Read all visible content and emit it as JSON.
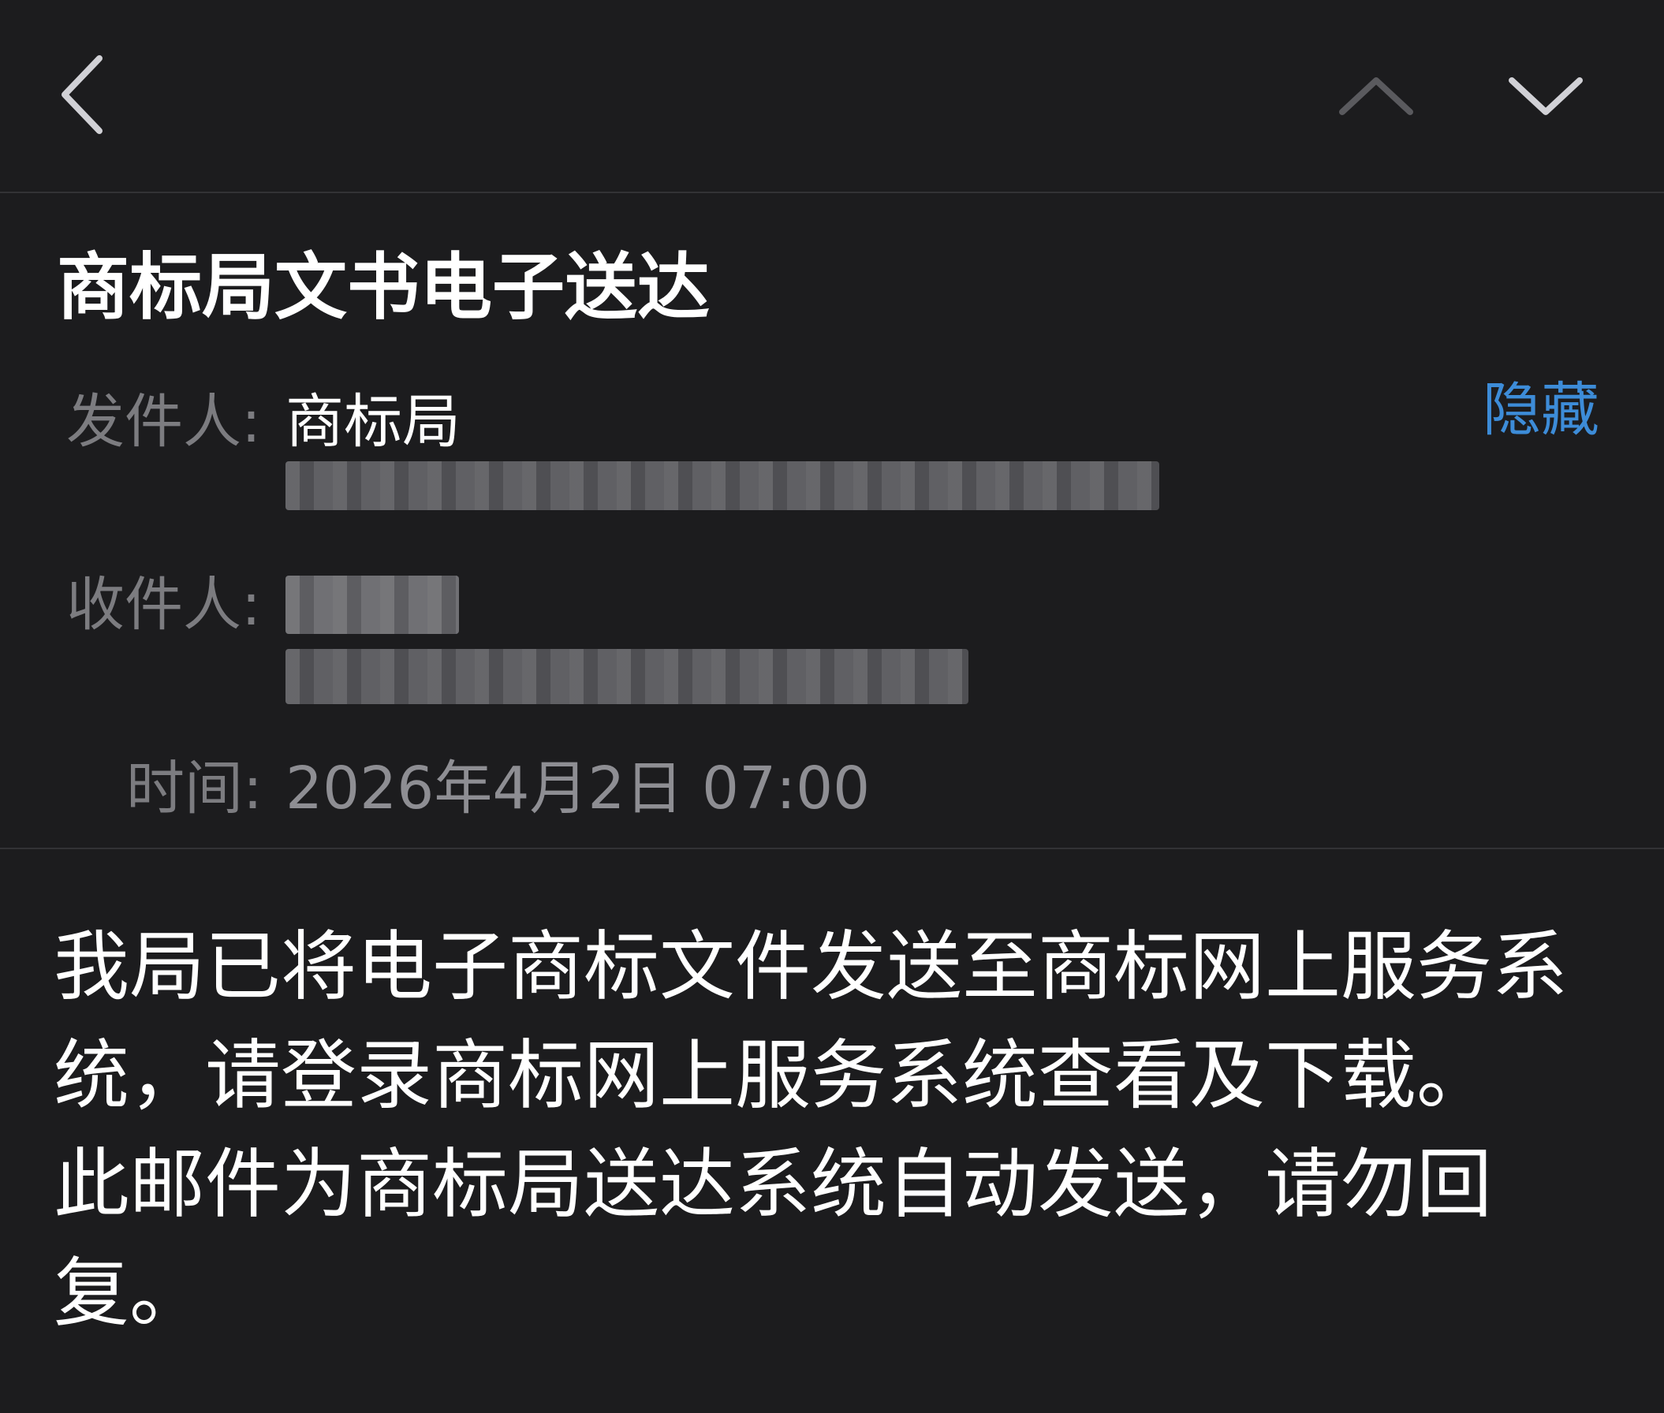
{
  "nav": {
    "back_icon": "chevron-left-icon",
    "prev_icon": "chevron-up-icon",
    "next_icon": "chevron-down-icon"
  },
  "email": {
    "subject": "商标局文书电子送达",
    "hide_label": "隐藏",
    "sender_label": "发件人:",
    "sender_name": "商标局",
    "recipient_label": "收件人:",
    "time_label": "时间:",
    "time_value": "2026年4月2日 07:00",
    "body_paragraphs": [
      "我局已将电子商标文件发送至商标网上服务系统，请登录商标网上服务系统查看及下载。",
      "此邮件为商标局送达系统自动发送，请勿回复。"
    ]
  },
  "colors": {
    "background": "#1c1c1e",
    "divider": "#323235",
    "accent_link": "#3d8cd8",
    "label_gray": "#7c7c80",
    "time_gray": "#8e8e93",
    "text": "#ffffff"
  }
}
